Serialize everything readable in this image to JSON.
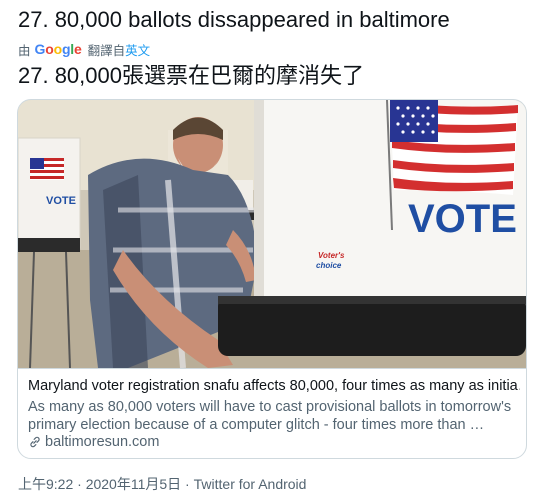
{
  "tweet": {
    "text": "27. 80,000 ballots dissappeared in baltimore",
    "translated_by_prefix": "由",
    "google_letters": [
      "G",
      "o",
      "o",
      "g",
      "l",
      "e"
    ],
    "translated_from": "翻譯自",
    "source_language": "英文",
    "translated_text": "27. 80,000張選票在巴爾的摩消失了"
  },
  "card": {
    "image_texts": {
      "vote_large": "VOTE",
      "vote_small": "VOTE",
      "brand_line1": "Voter's",
      "brand_line2": "choice"
    },
    "title": "Maryland voter registration snafu affects 80,000, four times as many as initia…",
    "description": "As many as 80,000 voters will have to cast provisional ballots in tomorrow's primary election because of a computer glitch - four times more than …",
    "domain": "baltimoresun.com"
  },
  "meta": {
    "time": "上午9:22",
    "separator": " · ",
    "date": "2020年11月5日",
    "client": "Twitter for Android"
  },
  "colors": {
    "link": "#1d9bf0",
    "muted": "#536471",
    "border": "#cfd9de",
    "vote_blue": "#1f4ea3",
    "flag_red": "#d32f2f"
  }
}
